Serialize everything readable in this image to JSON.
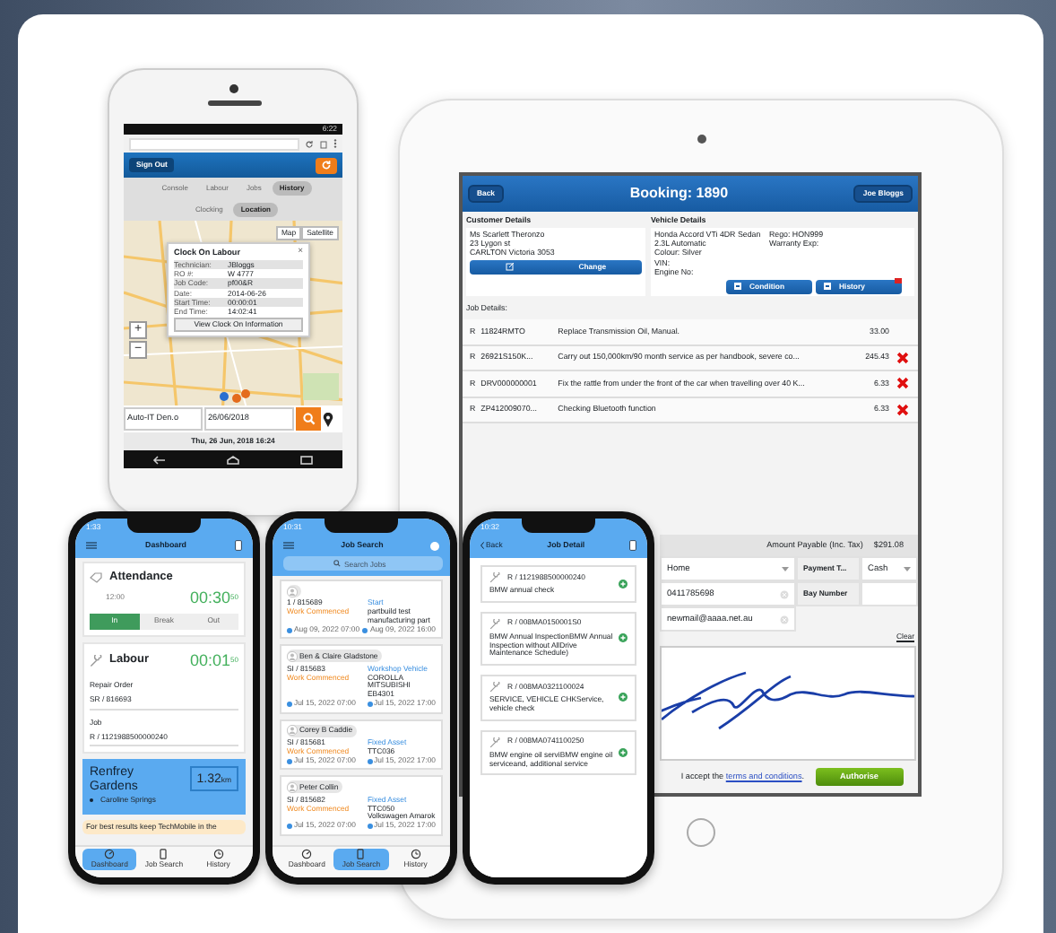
{
  "android_phone": {
    "status_time": "6:22",
    "sign_out": "Sign Out",
    "tabs": [
      {
        "label": "Console",
        "selected": false
      },
      {
        "label": "Labour",
        "selected": false
      },
      {
        "label": "Jobs",
        "selected": false
      },
      {
        "label": "History",
        "selected": true
      }
    ],
    "subtabs": [
      {
        "label": "Clocking",
        "selected": false
      },
      {
        "label": "Location",
        "selected": true
      }
    ],
    "map_buttons": [
      "Map",
      "Satellite"
    ],
    "popup": {
      "title": "Clock On Labour",
      "close": "×",
      "rows": [
        {
          "label": "Technician:",
          "value": "JBloggs"
        },
        {
          "label": "RO #:",
          "value": "W 4777"
        },
        {
          "label": "Job Code:",
          "value": "pf00&R"
        },
        {
          "label": "Date:",
          "value": "2014-06-26"
        },
        {
          "label": "Start Time:",
          "value": "00:00:01"
        },
        {
          "label": "End Time:",
          "value": "14:02:41"
        }
      ],
      "button": "View Clock On Information"
    },
    "zoom_in": "+",
    "zoom_out": "−",
    "name_field": "Auto-IT Den.o",
    "date_field": "26/06/2018",
    "footer_date": "Thu, 26 Jun, 2018 16:24"
  },
  "tablet": {
    "back": "Back",
    "title": "Booking: 1890",
    "user": "Joe Bloggs",
    "customer": {
      "heading": "Customer Details",
      "lines": [
        "Ms Scarlett Theronzo",
        "23 Lygon st",
        "CARLTON Victoria 3053"
      ],
      "button": "Change"
    },
    "vehicle": {
      "heading": "Vehicle Details",
      "lines": [
        "Honda Accord VTi 4DR Sedan",
        "2.3L Automatic",
        "Colour: Silver",
        "VIN:",
        "Engine No:"
      ],
      "rego": "Rego: HON999",
      "warranty": "Warranty Exp:",
      "buttons": [
        "Condition",
        "History"
      ]
    },
    "job_heading": "Job Details:",
    "jobs": [
      {
        "type": "R",
        "code": "11824RMTO",
        "description": "Replace Transmission Oil, Manual.",
        "amount": "33.00",
        "removable": false
      },
      {
        "type": "R",
        "code": "26921S150K...",
        "description": "Carry out 150,000km/90 month service as per handbook, severe co...",
        "amount": "245.43",
        "removable": true
      },
      {
        "type": "R",
        "code": "DRV000000001",
        "description": "Fix the rattle from under the front of the car when travelling over 40 K...",
        "amount": "6.33",
        "removable": true
      },
      {
        "type": "R",
        "code": "ZP412009070...",
        "description": "Checking Bluetooth function",
        "amount": "6.33",
        "removable": true
      }
    ],
    "amount_label": "Amount Payable (Inc. Tax)",
    "amount_value": "$291.08",
    "contact_select": "Home",
    "payment_label": "Payment T...",
    "payment_select": "Cash",
    "phone": "0411785698",
    "bay_label": "Bay Number",
    "email": "newmail@aaaa.net.au",
    "clear": "Clear",
    "terms_before": "I accept the",
    "terms_link": "terms and conditions",
    "terms_after": ".",
    "authorise": "Authorise"
  },
  "dashboard_phone": {
    "time": "1:33",
    "title": "Dashboard",
    "attendance": "Attendance",
    "attendance_time": "12:00",
    "attendance_timer": "00:30",
    "attendance_seconds": "50",
    "segments": [
      {
        "label": "In",
        "selected": true
      },
      {
        "label": "Break",
        "selected": false
      },
      {
        "label": "Out",
        "selected": false
      }
    ],
    "labour": "Labour",
    "labour_timer": "00:01",
    "labour_seconds": "50",
    "repair_order_label": "Repair Order",
    "repair_order": "SR / 816693",
    "job_label": "Job",
    "job": "R / 1121988500000240",
    "location": "Renfrey Gardens",
    "distance": "1.32",
    "distance_unit": "km",
    "suburb": "Caroline Springs",
    "tip": "For best results keep TechMobile in the",
    "tabs": [
      {
        "label": "Dashboard",
        "selected": true
      },
      {
        "label": "Job Search",
        "selected": false
      },
      {
        "label": "History",
        "selected": false
      }
    ]
  },
  "search_phone": {
    "time": "10:31",
    "title": "Job Search",
    "search": {
      "placeholder": "Search Jobs"
    },
    "jobs": [
      {
        "number": "1 / 815689",
        "status": "Work Commenced",
        "label": "Start",
        "details": "partbuild test manufacturing part",
        "start": "Aug 09, 2022 07:00",
        "end": "Aug 09, 2022 16:00"
      },
      {
        "customer": "Ben & Claire Gladstone",
        "number": "SI / 815683",
        "status": "Work Commenced",
        "label": "Workshop Vehicle",
        "details": "COROLLA MITSUBISHI EB4301",
        "start": "Jul 15, 2022 07:00",
        "end": "Jul 15, 2022 17:00"
      },
      {
        "customer": "Corey B Caddie",
        "number": "SI / 815681",
        "status": "Work Commenced",
        "label": "Fixed Asset",
        "details": "TTC036",
        "start": "Jul 15, 2022 07:00",
        "end": "Jul 15, 2022 17:00"
      },
      {
        "customer": "Peter Collin",
        "number": "SI / 815682",
        "status": "Work Commenced",
        "label": "Fixed Asset",
        "details": "TTC050 Volkswagen Amarok",
        "start": "Jul 15, 2022 07:00",
        "end": "Jul 15, 2022 17:00"
      }
    ],
    "tabs": [
      {
        "label": "Dashboard",
        "selected": false
      },
      {
        "label": "Job Search",
        "selected": true
      },
      {
        "label": "History",
        "selected": false
      }
    ]
  },
  "detail_phone": {
    "time": "10:32",
    "back": "Back",
    "title": "Job Detail",
    "items": [
      {
        "code": "R / 1121988500000240",
        "description": "BMW annual check"
      },
      {
        "code": "R / 008MA0150001S0",
        "description": "BMW Annual InspectionBMW Annual Inspection without AllDrive Maintenance Schedule)"
      },
      {
        "code": "R / 008MA0321100024",
        "description": "SERVICE, VEHICLE CHKService, vehicle check"
      },
      {
        "code": "R / 008MA0741100250",
        "description": "BMW engine oil serviBMW engine oil serviceand, additional service"
      }
    ]
  }
}
